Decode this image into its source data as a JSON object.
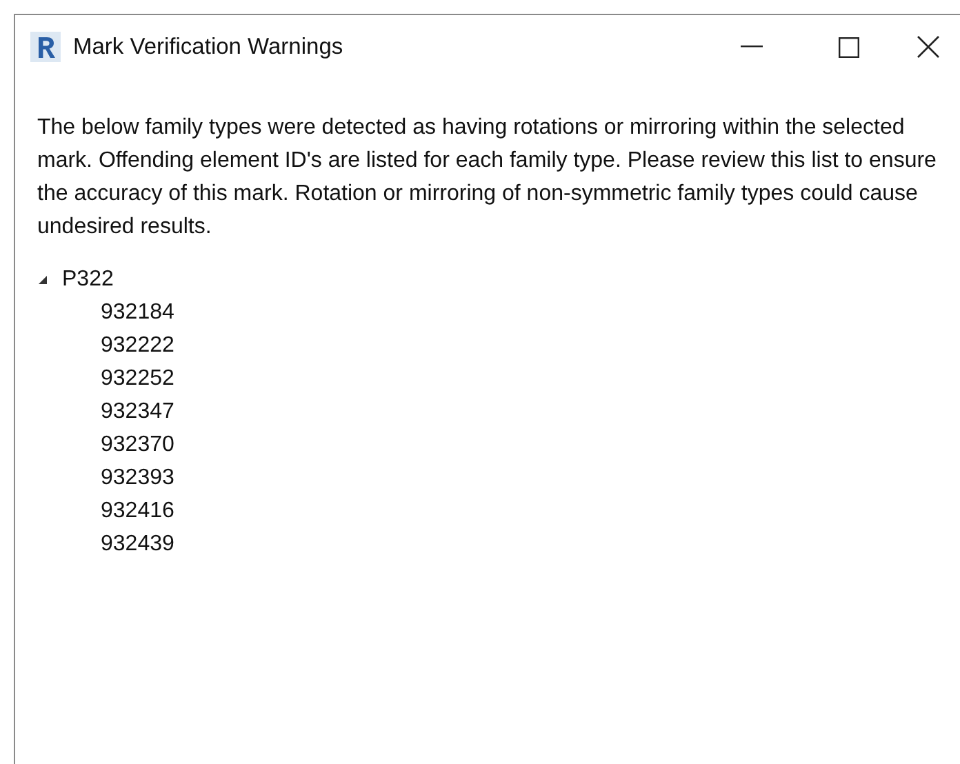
{
  "window": {
    "title": "Mark Verification Warnings"
  },
  "message": "The below family types were detected as having rotations or mirroring within the selected mark. Offending element ID's are listed for each family type. Please review this list to ensure the accuracy of this mark. Rotation or mirroring of non-symmetric family types could cause undesired results.",
  "tree": [
    {
      "label": "P322",
      "expanded": true,
      "children": [
        {
          "label": "932184"
        },
        {
          "label": "932222"
        },
        {
          "label": "932252"
        },
        {
          "label": "932347"
        },
        {
          "label": "932370"
        },
        {
          "label": "932393"
        },
        {
          "label": "932416"
        },
        {
          "label": "932439"
        }
      ]
    }
  ]
}
